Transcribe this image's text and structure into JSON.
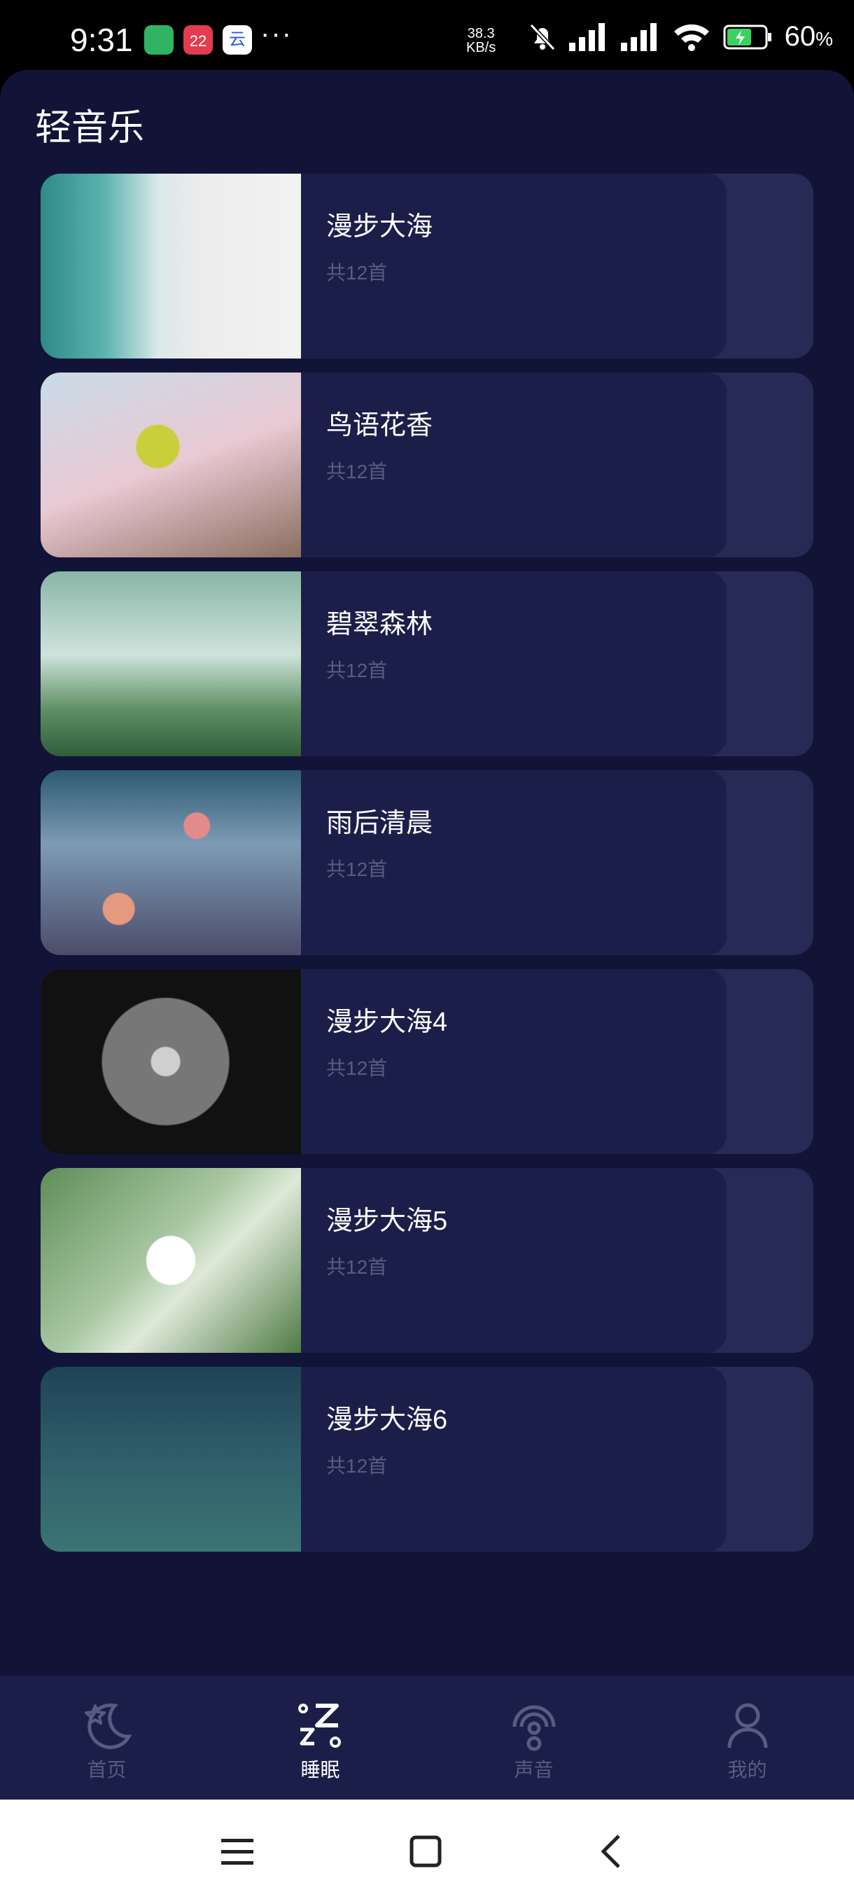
{
  "status_bar": {
    "time": "9:31",
    "app_badge": "22",
    "app_badge_cloud": "云",
    "more": "···",
    "net_speed_value": "38.3",
    "net_speed_unit": "KB/s",
    "battery_percent": "60",
    "battery_percent_sign": "%"
  },
  "header": {
    "title": "轻音乐"
  },
  "albums": [
    {
      "name": "漫步大海",
      "count": "共12首"
    },
    {
      "name": "鸟语花香",
      "count": "共12首"
    },
    {
      "name": "碧翠森林",
      "count": "共12首"
    },
    {
      "name": "雨后清晨",
      "count": "共12首"
    },
    {
      "name": "漫步大海4",
      "count": "共12首"
    },
    {
      "name": "漫步大海5",
      "count": "共12首"
    },
    {
      "name": "漫步大海6",
      "count": "共12首"
    }
  ],
  "bottom_nav": {
    "items": [
      {
        "label": "首页",
        "icon": "moon-star-icon"
      },
      {
        "label": "睡眠",
        "icon": "sleep-zz-icon",
        "active": true
      },
      {
        "label": "声音",
        "icon": "broadcast-icon"
      },
      {
        "label": "我的",
        "icon": "person-icon"
      }
    ]
  },
  "colors": {
    "background": "#111437",
    "card": "#1c1e4a",
    "rail": "#262a55",
    "muted_text": "#595c80"
  }
}
